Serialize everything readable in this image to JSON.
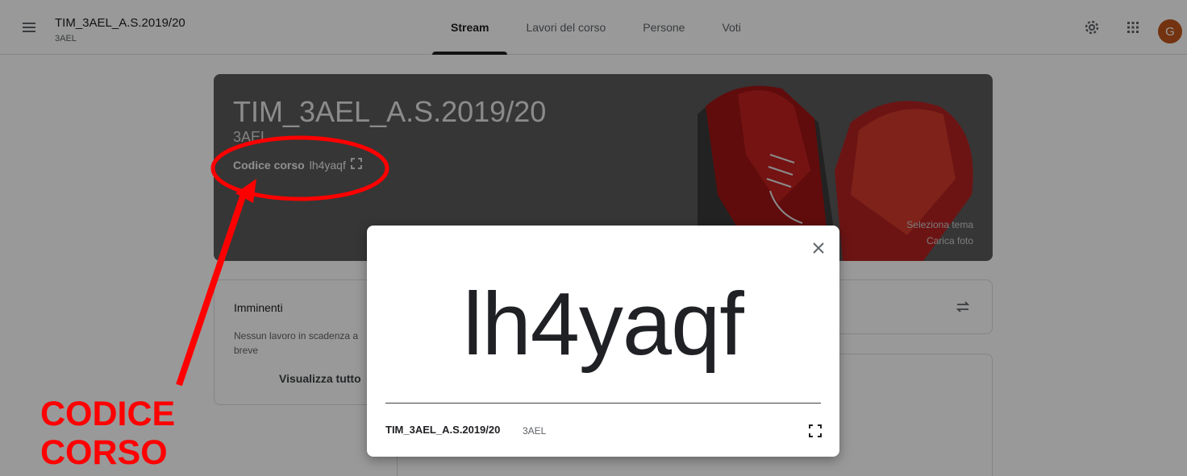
{
  "header": {
    "class_title": "TIM_3AEL_A.S.2019/20",
    "class_section": "3AEL",
    "tabs": [
      {
        "label": "Stream",
        "active": true
      },
      {
        "label": "Lavori del corso",
        "active": false
      },
      {
        "label": "Persone",
        "active": false
      },
      {
        "label": "Voti",
        "active": false
      }
    ],
    "avatar_initial": "G",
    "avatar_color": "#c0561b"
  },
  "banner": {
    "title": "TIM_3AEL_A.S.2019/20",
    "section": "3AEL",
    "code_label": "Codice corso",
    "code_value": "lh4yaqf",
    "select_theme": "Seleziona tema",
    "upload_photo": "Carica foto"
  },
  "upcoming": {
    "title": "Imminenti",
    "empty_text": "Nessun lavoro in scadenza a breve",
    "view_all": "Visualizza tutto"
  },
  "dialog": {
    "code": "lh4yaqf",
    "footer_title": "TIM_3AEL_A.S.2019/20",
    "footer_section": "3AEL"
  },
  "annotation": {
    "line1": "CODICE",
    "line2": "CORSO",
    "color": "#ff0000"
  }
}
